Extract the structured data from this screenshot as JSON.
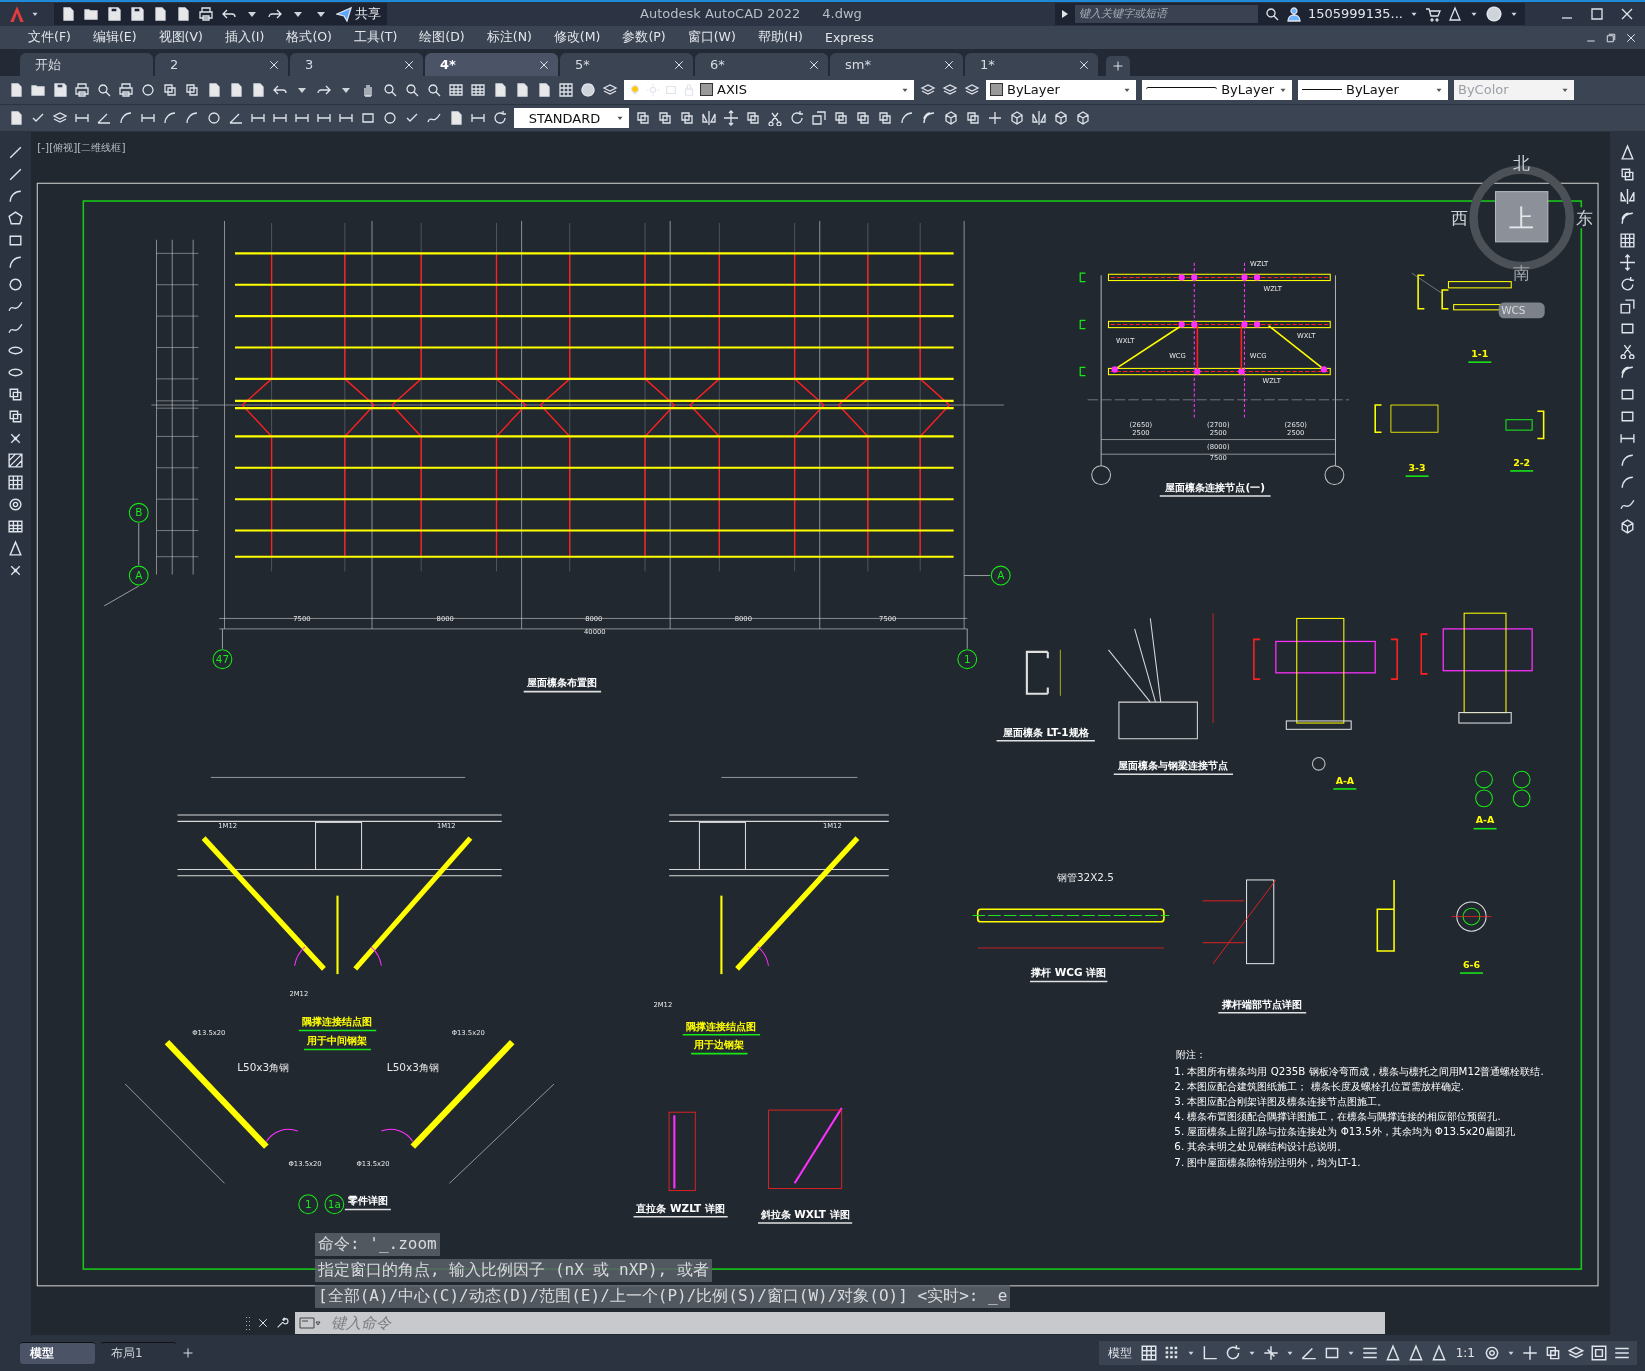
{
  "title_bar": {
    "share": "共享",
    "title": "Autodesk AutoCAD 2022",
    "file": "4.dwg",
    "search": {
      "placeholder": "键入关键字或短语"
    },
    "user": "1505999135..."
  },
  "menu": [
    "文件(F)",
    "编辑(E)",
    "视图(V)",
    "插入(I)",
    "格式(O)",
    "工具(T)",
    "绘图(D)",
    "标注(N)",
    "修改(M)",
    "参数(P)",
    "窗口(W)",
    "帮助(H)",
    "Express"
  ],
  "tabs": [
    {
      "label": "开始",
      "selected": false
    },
    {
      "label": "2",
      "selected": false
    },
    {
      "label": "3",
      "selected": false
    },
    {
      "label": "4*",
      "selected": true
    },
    {
      "label": "5*",
      "selected": false
    },
    {
      "label": "6*",
      "selected": false
    },
    {
      "label": "sm*",
      "selected": false
    },
    {
      "label": "1*",
      "selected": false
    }
  ],
  "properties": {
    "layer": "AXIS",
    "color_control": "ByLayer",
    "linetype": "ByLayer",
    "lineweight": "ByLayer",
    "plot_style": "ByColor",
    "text_style": "STANDARD"
  },
  "viewport_label": "[-][俯视][二维线框]",
  "viewcube": {
    "north": "北",
    "west": "西",
    "east": "东",
    "south": "南",
    "face": "上",
    "ucs": "WCS"
  },
  "titles": [
    {
      "text": "屋面檩条布置图",
      "kind": "caption"
    },
    {
      "text": "屋面檩条连接节点(一)",
      "kind": "caption"
    },
    {
      "text": "1-1",
      "kind": "section"
    },
    {
      "text": "3-3",
      "kind": "section"
    },
    {
      "text": "2-2",
      "kind": "section"
    },
    {
      "text": "屋面檩条 LT-1规格",
      "kind": "caption"
    },
    {
      "text": "屋面檩条与钢梁连接节点",
      "kind": "caption"
    },
    {
      "text": "A-A",
      "kind": "section"
    },
    {
      "text": "A-A",
      "kind": "section"
    },
    {
      "text": "隅撑连接结点图",
      "kind": "section"
    },
    {
      "text": "用于中间钢架",
      "kind": "section"
    },
    {
      "text": "隅撑连接结点图",
      "kind": "section"
    },
    {
      "text": "用于边钢架",
      "kind": "section"
    },
    {
      "text": "零件详图",
      "kind": "caption"
    },
    {
      "text": "直拉条 WZLT 详图",
      "kind": "caption"
    },
    {
      "text": "斜拉条 WXLT 详图",
      "kind": "caption"
    },
    {
      "text": "撑杆 WCG 详图",
      "kind": "caption"
    },
    {
      "text": "撑杆端部节点详图",
      "kind": "caption"
    },
    {
      "text": "6-6",
      "kind": "section"
    }
  ],
  "labels": [
    {
      "text": "7500",
      "kind": "dim"
    },
    {
      "text": "8000",
      "kind": "dim"
    },
    {
      "text": "8000",
      "kind": "dim"
    },
    {
      "text": "8000",
      "kind": "dim"
    },
    {
      "text": "7500",
      "kind": "dim"
    },
    {
      "text": "40000",
      "kind": "dim"
    },
    {
      "text": "B",
      "kind": "bubble"
    },
    {
      "text": "A",
      "kind": "bubble"
    },
    {
      "text": "A",
      "kind": "bubble"
    },
    {
      "text": "47",
      "kind": "bubble"
    },
    {
      "text": "1",
      "kind": "bubble"
    },
    {
      "text": "WZLT",
      "kind": "dim"
    },
    {
      "text": "WZLT",
      "kind": "dim"
    },
    {
      "text": "WXLT",
      "kind": "dim"
    },
    {
      "text": "WXLT",
      "kind": "dim"
    },
    {
      "text": "WCG",
      "kind": "dim"
    },
    {
      "text": "WCG",
      "kind": "dim"
    },
    {
      "text": "WZLT",
      "kind": "dim"
    },
    {
      "text": "(2650)",
      "kind": "dim"
    },
    {
      "text": "2500",
      "kind": "dim"
    },
    {
      "text": "(2700)",
      "kind": "dim"
    },
    {
      "text": "2500",
      "kind": "dim"
    },
    {
      "text": "(2650)",
      "kind": "dim"
    },
    {
      "text": "2500",
      "kind": "dim"
    },
    {
      "text": "(8000)",
      "kind": "dim"
    },
    {
      "text": "7500",
      "kind": "dim"
    },
    {
      "text": "1M12",
      "kind": "dim"
    },
    {
      "text": "1M12",
      "kind": "dim"
    },
    {
      "text": "1M12",
      "kind": "dim"
    },
    {
      "text": "2M12",
      "kind": "dim"
    },
    {
      "text": "2M12",
      "kind": "dim"
    },
    {
      "text": "Φ13.5x20",
      "kind": "dim"
    },
    {
      "text": "Φ13.5x20",
      "kind": "dim"
    },
    {
      "text": "L50x3角钢",
      "kind": "dim"
    },
    {
      "text": "L50x3角钢",
      "kind": "dim"
    },
    {
      "text": "Φ13.5x20",
      "kind": "dim"
    },
    {
      "text": "Φ13.5x20",
      "kind": "dim"
    },
    {
      "text": "钢管32X2.5",
      "kind": "dim"
    },
    {
      "text": "1",
      "kind": "bubble"
    },
    {
      "text": "1a",
      "kind": "bubble"
    }
  ],
  "notes": {
    "heading": "附注：",
    "lines": [
      "1. 本图所有檩条均用 Q235B 钢板冷弯而成，檩条与檩托之间用M12普通螺栓联结.",
      "2. 本图应配合建筑图纸施工；  檩条长度及螺栓孔位置需放样确定.",
      "3. 本图应配合刚架详图及檩条连接节点图施工。",
      "4. 檩条布置图须配合隅撑详图施工，在檩条与隅撑连接的相应部位预留孔.",
      "5. 屋面檩条上留孔除与拉条连接处为 Φ13.5外，其余均为 Φ13.5x20扁圆孔",
      "6. 其余未明之处见钢结构设计总说明。",
      "7. 图中屋面檩条除特别注明外，均为LT-1."
    ]
  },
  "command_history": [
    "命令: '_.zoom",
    "指定窗口的角点, 输入比例因子 (nX 或 nXP), 或者",
    "[全部(A)/中心(C)/动态(D)/范围(E)/上一个(P)/比例(S)/窗口(W)/对象(O)] <实时>: _e"
  ],
  "command_input": {
    "placeholder": "键入命令"
  },
  "layout_tabs": [
    {
      "label": "模型",
      "selected": true
    },
    {
      "label": "布局1",
      "selected": false
    }
  ],
  "status_bar": {
    "space": "模型",
    "scale": "1:1"
  }
}
